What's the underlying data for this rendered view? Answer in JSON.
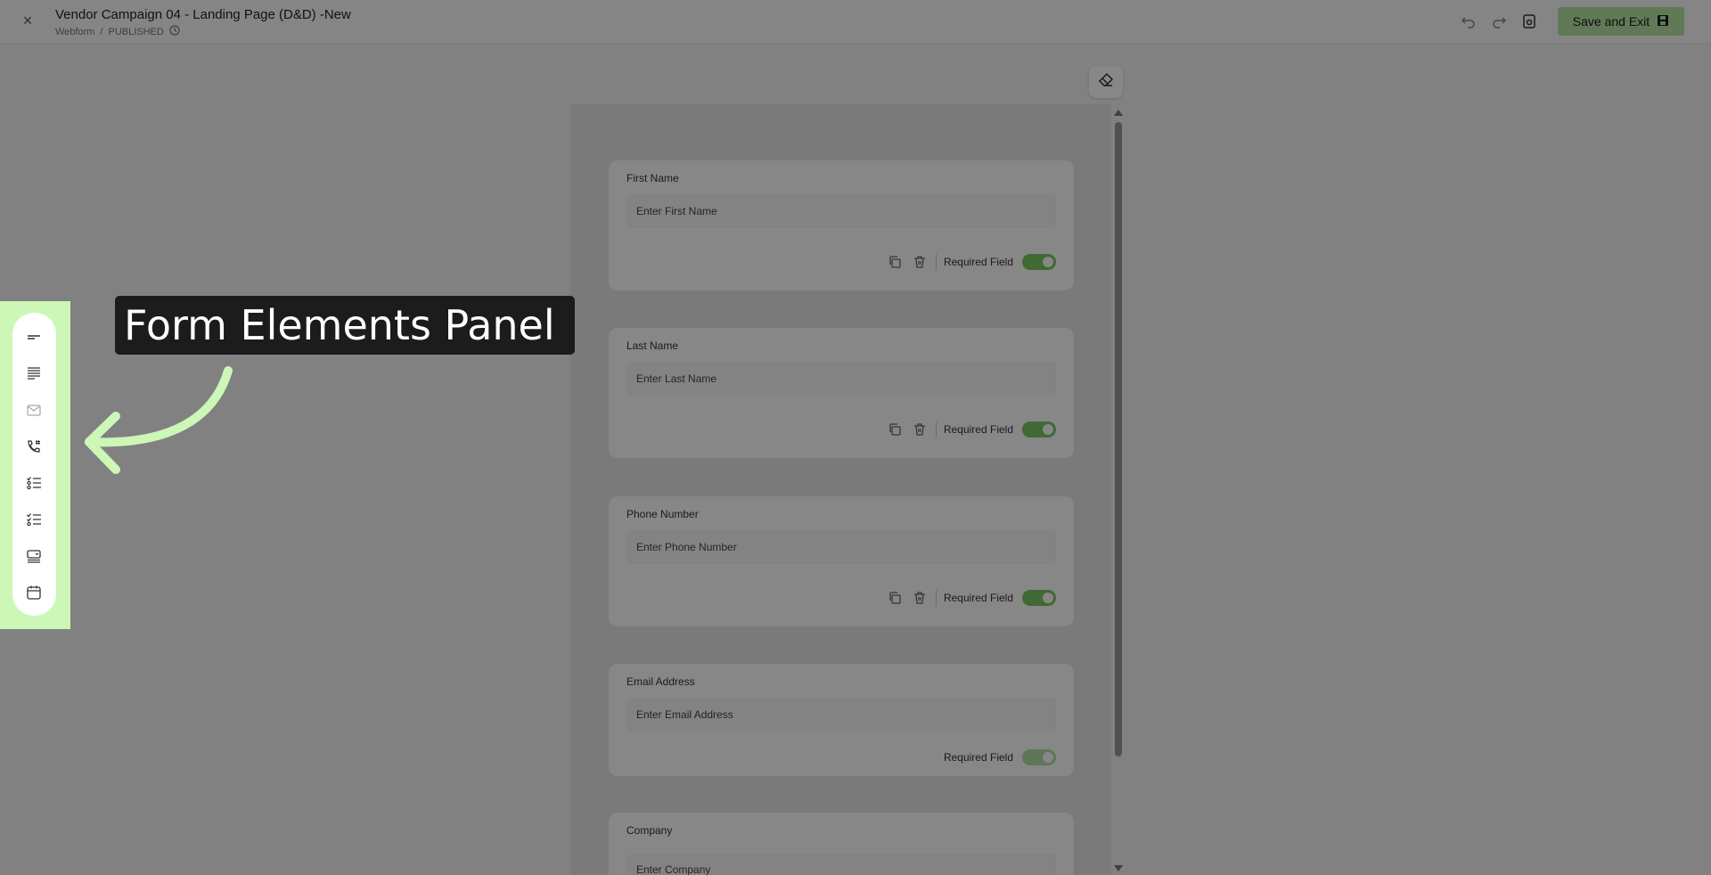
{
  "header": {
    "title": "Vendor Campaign 04 - Landing Page (D&D) -New",
    "breadcrumb": {
      "type": "Webform",
      "separator": "/",
      "status": "PUBLISHED"
    },
    "save_label": "Save and Exit",
    "icons": [
      "close-icon",
      "undo-icon",
      "redo-icon",
      "preview-icon",
      "save-icon",
      "clock-icon"
    ]
  },
  "form": {
    "fields": [
      {
        "label": "First Name",
        "placeholder": "Enter First Name",
        "required_label": "Required Field",
        "required": true
      },
      {
        "label": "Last Name",
        "placeholder": "Enter Last Name",
        "required_label": "Required Field",
        "required": true
      },
      {
        "label": "Phone Number",
        "placeholder": "Enter Phone Number",
        "required_label": "Required Field",
        "required": true
      },
      {
        "label": "Email Address",
        "placeholder": "Enter Email Address",
        "required_label": "Required Field",
        "required": true
      },
      {
        "label": "Company",
        "placeholder": "Enter Company"
      }
    ]
  },
  "panel": {
    "tools": [
      "short-text-icon",
      "paragraph-icon",
      "email-icon",
      "phone-icon",
      "single-choice-icon",
      "multi-choice-icon",
      "dropdown-icon",
      "date-icon"
    ]
  },
  "annotation": {
    "callout_text": "Form Elements Panel",
    "highlight_color": "#ccf7b6"
  },
  "colors": {
    "accent": "#7cc660",
    "save_button": "#b6e6a4"
  }
}
